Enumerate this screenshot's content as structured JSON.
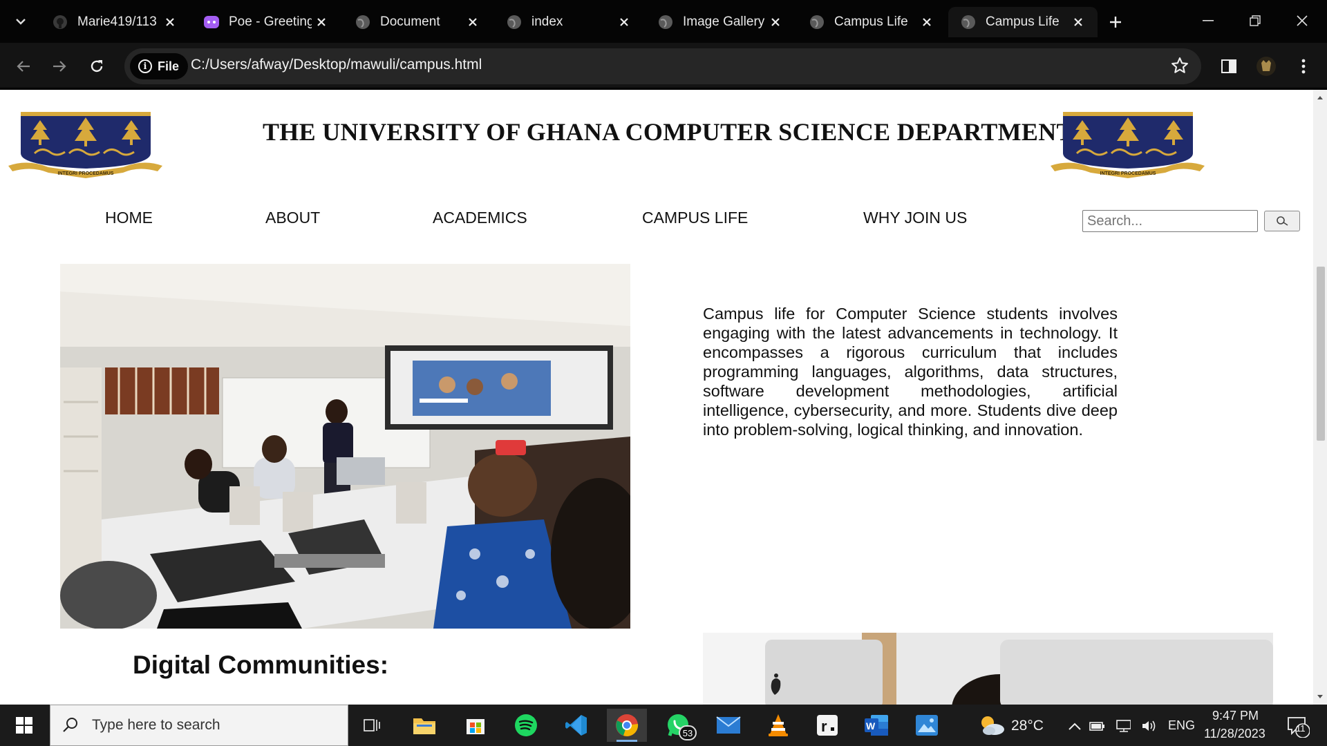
{
  "browser": {
    "tabs": [
      {
        "title": "Marie419/113",
        "icon": "github-icon"
      },
      {
        "title": "Poe - Greeting",
        "icon": "poe-icon"
      },
      {
        "title": "Document",
        "icon": "globe-icon"
      },
      {
        "title": "index",
        "icon": "globe-icon"
      },
      {
        "title": "Image Gallery",
        "icon": "globe-icon"
      },
      {
        "title": "Campus Life",
        "icon": "globe-icon"
      },
      {
        "title": "Campus Life",
        "icon": "globe-icon",
        "active": true
      }
    ],
    "address": {
      "chip_label": "File",
      "url": "C:/Users/afway/Desktop/mawuli/campus.html"
    }
  },
  "page": {
    "title": "THE UNIVERSITY OF GHANA COMPUTER SCIENCE DEPARTMENT",
    "crest_motto": "INTEGRI PROCEDAMUS",
    "nav": [
      "HOME",
      "ABOUT",
      "ACADEMICS",
      "CAMPUS LIFE",
      "WHY JOIN US"
    ],
    "search": {
      "placeholder": "Search..."
    },
    "intro": "Campus life for Computer Science students involves engaging with the latest advancements in technology. It encompasses a rigorous curriculum that includes programming languages, algorithms, data structures, software development methodologies, artificial intelligence, cybersecurity, and more. Students dive deep into problem-solving, logical thinking, and innovation.",
    "section_heading": "Digital Communities:"
  },
  "taskbar": {
    "search_placeholder": "Type here to search",
    "whatsapp_badge": "53",
    "weather": "28°C",
    "language": "ENG",
    "time": "9:47 PM",
    "date": "11/28/2023",
    "notifications": "11"
  },
  "colors": {
    "crest_navy": "#1f2a6b",
    "crest_gold": "#d7a93c",
    "chrome_dark": "#141414"
  }
}
